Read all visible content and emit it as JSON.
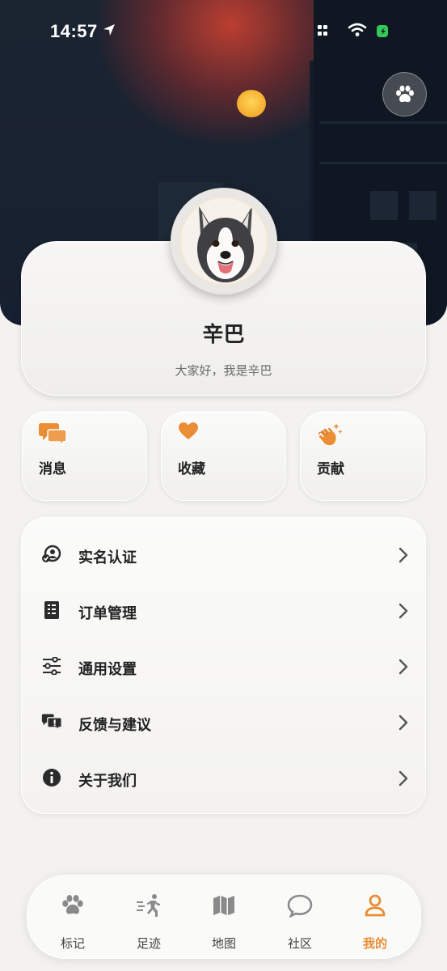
{
  "status_bar": {
    "time": "14:57"
  },
  "profile": {
    "name": "辛巴",
    "bio": "大家好，我是辛巴"
  },
  "quick_actions": [
    {
      "label": "消息",
      "icon": "chat-bubbles-icon"
    },
    {
      "label": "收藏",
      "icon": "heart-icon"
    },
    {
      "label": "贡献",
      "icon": "clapping-hands-icon"
    }
  ],
  "menu": [
    {
      "label": "实名认证",
      "icon": "verified-user-icon"
    },
    {
      "label": "订单管理",
      "icon": "receipt-icon"
    },
    {
      "label": "通用设置",
      "icon": "sliders-icon"
    },
    {
      "label": "反馈与建议",
      "icon": "feedback-icon"
    },
    {
      "label": "关于我们",
      "icon": "info-icon"
    }
  ],
  "tabs": [
    {
      "label": "标记",
      "icon": "paw-icon",
      "active": false
    },
    {
      "label": "足迹",
      "icon": "running-icon",
      "active": false
    },
    {
      "label": "地图",
      "icon": "map-icon",
      "active": false
    },
    {
      "label": "社区",
      "icon": "chat-bubble-icon",
      "active": false
    },
    {
      "label": "我的",
      "icon": "person-icon",
      "active": true
    }
  ],
  "colors": {
    "accent": "#ea8d34",
    "icon_gray": "#8a8a8a",
    "text_dark": "#222222"
  }
}
